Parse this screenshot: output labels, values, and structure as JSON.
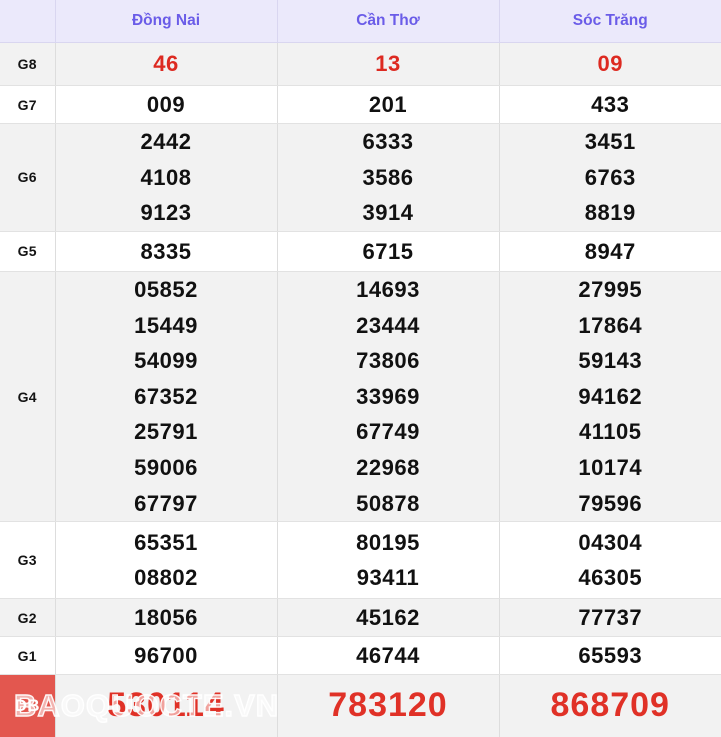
{
  "table": {
    "label_column_header": "",
    "provinces": [
      "Đồng Nai",
      "Cần Thơ",
      "Sóc Trăng"
    ],
    "rows": [
      {
        "label": "G8",
        "style": "red",
        "values": [
          [
            "46"
          ],
          [
            "13"
          ],
          [
            "09"
          ]
        ]
      },
      {
        "label": "G7",
        "style": "normal",
        "values": [
          [
            "009"
          ],
          [
            "201"
          ],
          [
            "433"
          ]
        ]
      },
      {
        "label": "G6",
        "style": "normal",
        "values": [
          [
            "2442",
            "4108",
            "9123"
          ],
          [
            "6333",
            "3586",
            "3914"
          ],
          [
            "3451",
            "6763",
            "8819"
          ]
        ]
      },
      {
        "label": "G5",
        "style": "normal",
        "values": [
          [
            "8335"
          ],
          [
            "6715"
          ],
          [
            "8947"
          ]
        ]
      },
      {
        "label": "G4",
        "style": "normal",
        "values": [
          [
            "05852",
            "15449",
            "54099",
            "67352",
            "25791",
            "59006",
            "67797"
          ],
          [
            "14693",
            "23444",
            "73806",
            "33969",
            "67749",
            "22968",
            "50878"
          ],
          [
            "27995",
            "17864",
            "59143",
            "94162",
            "41105",
            "10174",
            "79596"
          ]
        ]
      },
      {
        "label": "G3",
        "style": "normal",
        "values": [
          [
            "65351",
            "08802"
          ],
          [
            "80195",
            "93411"
          ],
          [
            "04304",
            "46305"
          ]
        ]
      },
      {
        "label": "G2",
        "style": "normal",
        "values": [
          [
            "18056"
          ],
          [
            "45162"
          ],
          [
            "77737"
          ]
        ]
      },
      {
        "label": "G1",
        "style": "normal",
        "values": [
          [
            "96700"
          ],
          [
            "46744"
          ],
          [
            "65593"
          ]
        ]
      },
      {
        "label": "DB",
        "style": "special",
        "values": [
          [
            "530114"
          ],
          [
            "783120"
          ],
          [
            "868709"
          ]
        ]
      }
    ]
  },
  "watermark": {
    "text": "BAOQUOCTE.VN"
  },
  "colors": {
    "header_bg": "#ebe9fb",
    "header_text": "#6a5ce8",
    "red_number": "#dd2a21",
    "special_number": "#e03127",
    "special_badge_bg": "#e3574f",
    "row_shade": "#f2f2f2",
    "row_plain": "#ffffff",
    "border": "#e2e2e2"
  }
}
